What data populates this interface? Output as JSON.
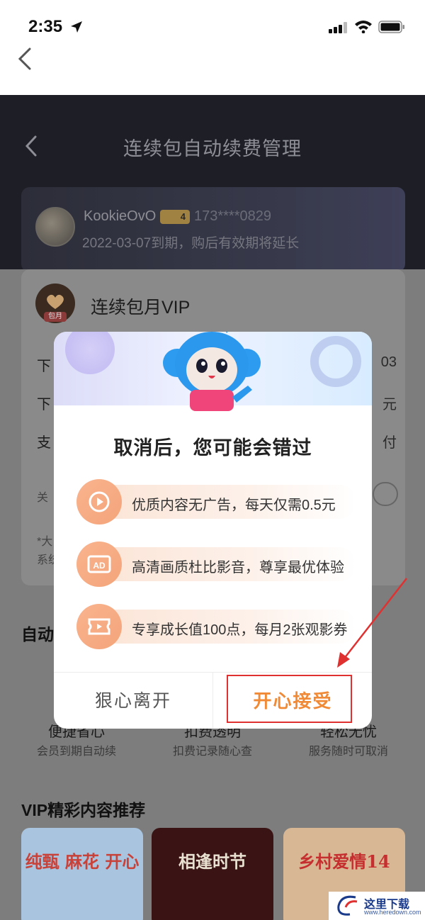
{
  "status_bar": {
    "time": "2:35"
  },
  "page": {
    "title": "连续包自动续费管理",
    "user": {
      "name": "KookieOvO",
      "level": "4",
      "phone": "173****0829",
      "expire_text": "2022-03-07到期，购后有效期将延长"
    },
    "vip": {
      "logo_tag": "包月",
      "title": "连续包月VIP",
      "rows": [
        {
          "label": "下",
          "value": "03"
        },
        {
          "label": "下",
          "value": "元"
        },
        {
          "label": "支",
          "value": "付"
        }
      ],
      "close_label": "关",
      "note": "*大",
      "note2": "系统"
    },
    "section_auto": "自动",
    "features": [
      {
        "label": "便捷省心",
        "sub": "会员到期自动续"
      },
      {
        "label": "扣费透明",
        "sub": "扣费记录随心查"
      },
      {
        "label": "轻松无忧",
        "sub": "服务随时可取消"
      }
    ],
    "section_recommend": "VIP精彩内容推荐",
    "thumbs": [
      {
        "text": "纯甄 麻花 开心",
        "bg": "#b8d4ee",
        "color": "#c8423a"
      },
      {
        "text": "相逢时节",
        "bg": "#3a1414",
        "color": "#e8e0d0"
      },
      {
        "text": "乡村爱情14",
        "bg": "#e8c9a6",
        "color": "#c52f2f"
      }
    ]
  },
  "dialog": {
    "title": "取消后，您可能会错过",
    "benefits": [
      {
        "icon": "play-icon",
        "text": "优质内容无广告，每天仅需0.5元"
      },
      {
        "icon": "ad-icon",
        "text": "高清画质杜比影音，尊享最优体验"
      },
      {
        "icon": "ticket-icon",
        "text": "专享成长值100点，每月2张观影券"
      }
    ],
    "leave_label": "狠心离开",
    "accept_label": "开心接受"
  },
  "watermark": {
    "text": "这里下载",
    "url": "www.heredown.com"
  },
  "colors": {
    "accent": "#f08a36",
    "highlight": "#e03131"
  }
}
